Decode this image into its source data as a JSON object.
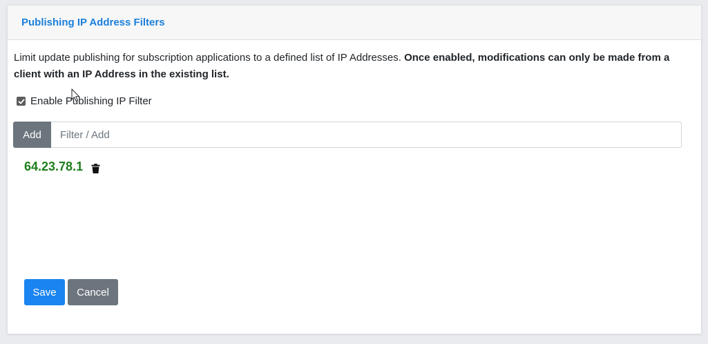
{
  "panel": {
    "title": "Publishing IP Address Filters"
  },
  "description": {
    "text": "Limit update publishing for subscription applications to a defined list of IP Addresses. ",
    "bold_text": "Once enabled, modifications can only be made from a client with an IP Address in the existing list."
  },
  "filter_toggle": {
    "label": "Enable Publishing IP Filter",
    "checked": true
  },
  "add_filter": {
    "button_label": "Add",
    "placeholder": "Filter / Add",
    "value": ""
  },
  "ip_list": [
    {
      "address": "64.23.78.1",
      "icon": "trash-icon"
    }
  ],
  "footer": {
    "save_label": "Save",
    "cancel_label": "Cancel"
  },
  "colors": {
    "title": "#1a7fdb",
    "ip_text": "#1e7e1e",
    "primary_button": "#1a84f0",
    "secondary_button": "#6c757d"
  }
}
